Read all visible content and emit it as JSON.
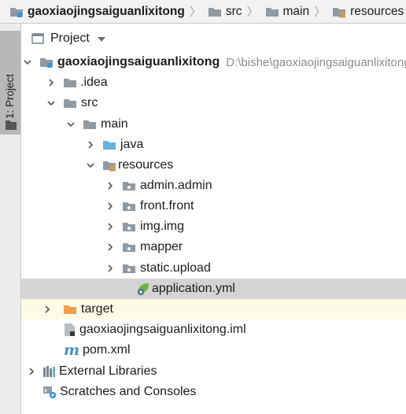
{
  "breadcrumb": {
    "items": [
      {
        "label": "gaoxiaojingsaiguanlixitong",
        "icon": "module-folder-icon"
      },
      {
        "label": "src",
        "icon": "folder-icon"
      },
      {
        "label": "main",
        "icon": "folder-icon"
      },
      {
        "label": "resources",
        "icon": "resources-folder-icon"
      }
    ]
  },
  "tool_window": {
    "stripe_label": "1: Project",
    "view_label": "Project"
  },
  "tree": {
    "root": {
      "label": "gaoxiaojingsaiguanlixitong",
      "path": "D:\\bishe\\gaoxiaojingsaiguanlixitong"
    },
    "idea": "idea",
    "idea_prefix": ".",
    "src": "src",
    "main": "main",
    "java": "java",
    "resources": "resources",
    "admin": "admin.admin",
    "front": "front.front",
    "img": "img.img",
    "mapper": "mapper",
    "static": "static.upload",
    "application": "application.yml",
    "target": "target",
    "iml": "gaoxiaojingsaiguanlixitong.iml",
    "pom": "pom.xml",
    "ext_libs": "External Libraries",
    "scratches": "Scratches and Consoles"
  },
  "colors": {
    "folder": "#8f9aa3",
    "java_folder": "#63b3de",
    "target_folder": "#f0a04b",
    "spring_leaf": "#6db33f",
    "selection": "#d4d4d4"
  }
}
